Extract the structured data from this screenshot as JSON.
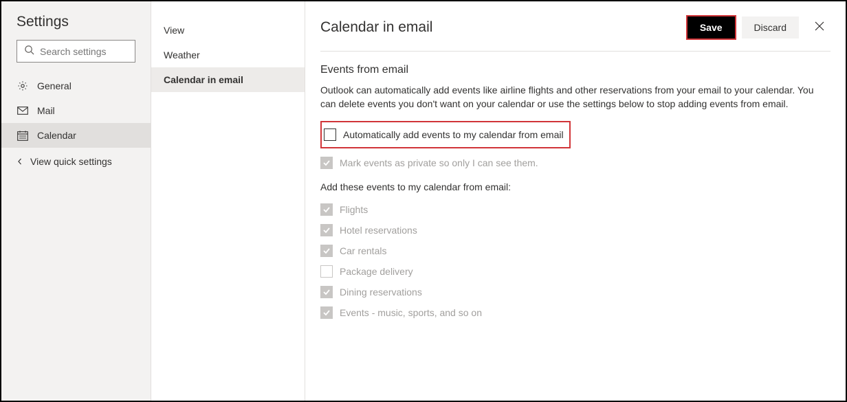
{
  "sidebar": {
    "title": "Settings",
    "searchPlaceholder": "Search settings",
    "nav": [
      {
        "label": "General"
      },
      {
        "label": "Mail"
      },
      {
        "label": "Calendar"
      }
    ],
    "quickSettings": "View quick settings"
  },
  "subnav": {
    "items": [
      {
        "label": "View"
      },
      {
        "label": "Weather"
      },
      {
        "label": "Calendar in email"
      }
    ]
  },
  "header": {
    "title": "Calendar in email",
    "save": "Save",
    "discard": "Discard"
  },
  "section": {
    "title": "Events from email",
    "desc": "Outlook can automatically add events like airline flights and other reservations from your email to your calendar. You can delete events you don't want on your calendar or use the settings below to stop adding events from email.",
    "autoAdd": "Automatically add events to my calendar from email",
    "markPrivate": "Mark events as private so only I can see them.",
    "addTheseLabel": "Add these events to my calendar from email:",
    "events": [
      {
        "label": "Flights",
        "checked": true
      },
      {
        "label": "Hotel reservations",
        "checked": true
      },
      {
        "label": "Car rentals",
        "checked": true
      },
      {
        "label": "Package delivery",
        "checked": false
      },
      {
        "label": "Dining reservations",
        "checked": true
      },
      {
        "label": "Events - music, sports, and so on",
        "checked": true
      }
    ]
  }
}
